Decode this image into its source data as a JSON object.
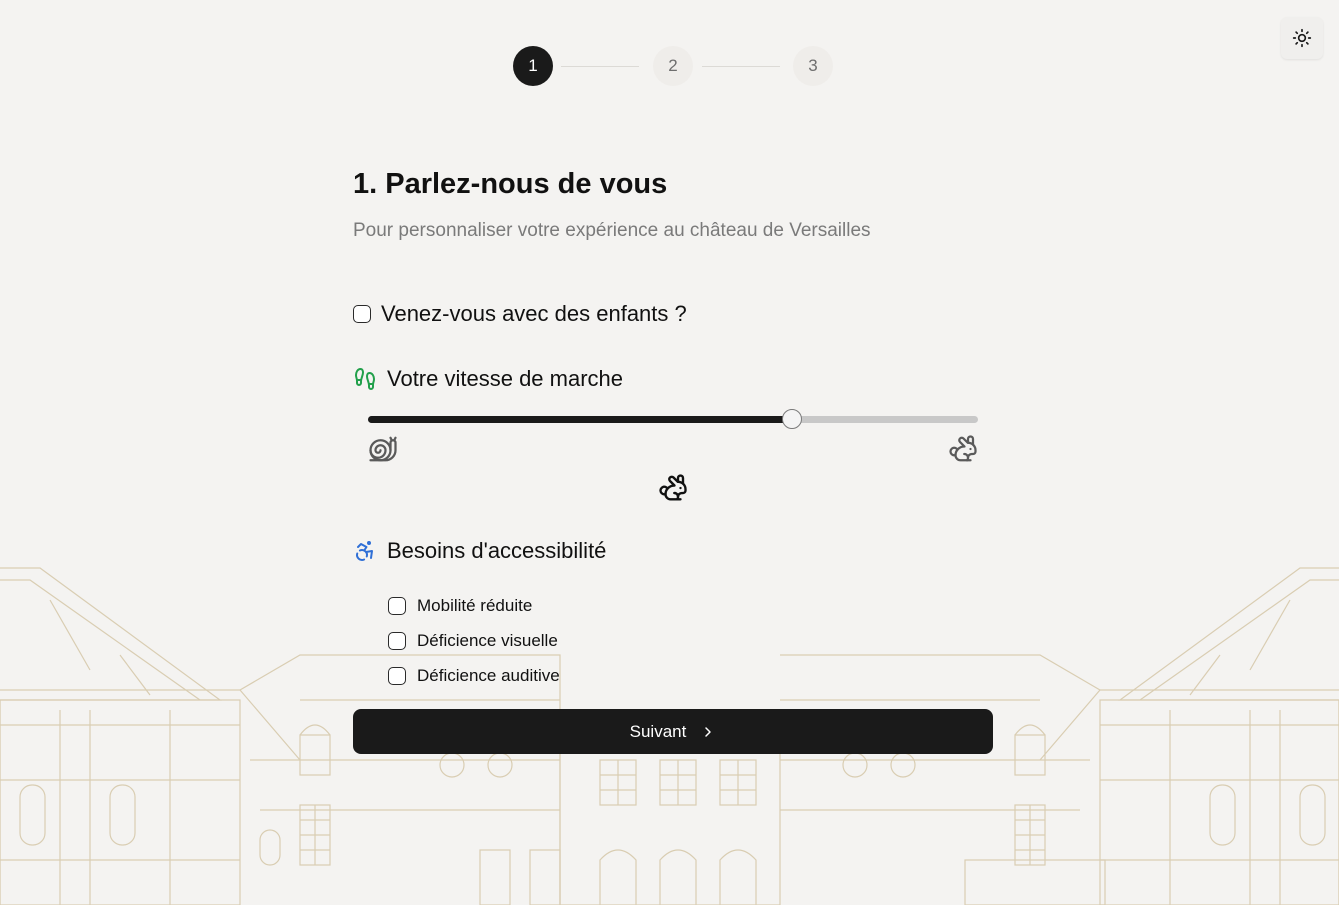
{
  "colors": {
    "primary": "#1a1a1a",
    "background": "#f4f3f1",
    "walk_icon": "#22a04b",
    "accessibility_icon": "#2f6fd6",
    "slider_track": "#c8c8c8"
  },
  "theme_toggle": {
    "icon": "sun-icon"
  },
  "stepper": {
    "steps": [
      "1",
      "2",
      "3"
    ],
    "current": 1
  },
  "header": {
    "title": "1. Parlez-nous de vous",
    "subtitle": "Pour personnaliser votre expérience au château de Versailles"
  },
  "children": {
    "label": "Venez-vous avec des enfants ?",
    "checked": false
  },
  "speed": {
    "label": "Votre vitesse de marche",
    "icon": "footprints-icon",
    "min_icon": "snail-icon",
    "max_icon": "rabbit-icon",
    "current_icon": "rabbit-icon",
    "value_fraction": 0.695
  },
  "accessibility": {
    "label": "Besoins d'accessibilité",
    "icon": "accessibility-icon",
    "options": [
      {
        "label": "Mobilité réduite",
        "checked": false
      },
      {
        "label": "Déficience visuelle",
        "checked": false
      },
      {
        "label": "Déficience auditive",
        "checked": false
      }
    ]
  },
  "next_button": {
    "label": "Suivant",
    "icon": "chevron-right-icon"
  }
}
